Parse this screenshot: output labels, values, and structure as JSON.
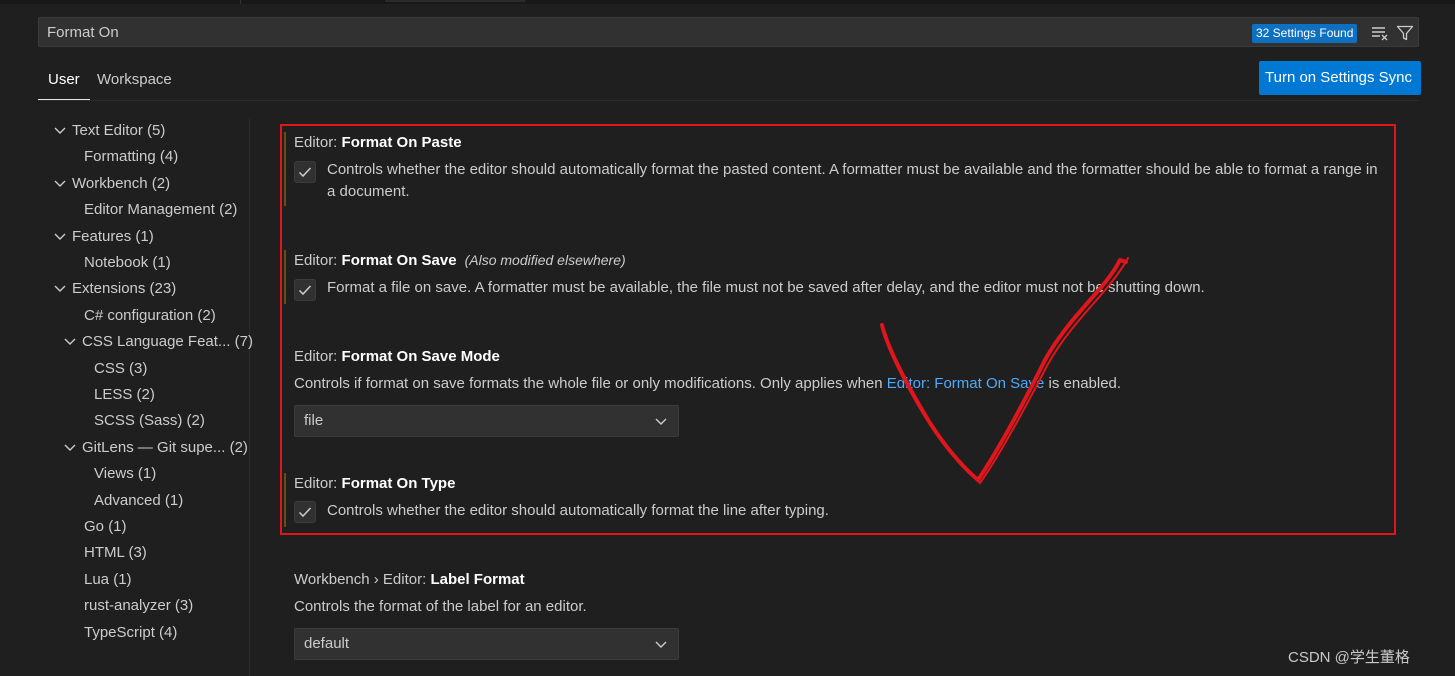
{
  "search": {
    "value": "Format On",
    "results_badge": "32 Settings Found"
  },
  "scope_tabs": [
    {
      "label": "User",
      "active": true
    },
    {
      "label": "Workspace",
      "active": false
    }
  ],
  "sync_button": {
    "label": "Turn on Settings Sync"
  },
  "toc": [
    {
      "label": "Text Editor",
      "count": "(5)",
      "expanded": true,
      "level": 0
    },
    {
      "label": "Formatting",
      "count": "(4)",
      "level": 1
    },
    {
      "label": "Workbench",
      "count": "(2)",
      "expanded": true,
      "level": 0
    },
    {
      "label": "Editor Management",
      "count": "(2)",
      "level": 1
    },
    {
      "label": "Features",
      "count": "(1)",
      "expanded": true,
      "level": 0
    },
    {
      "label": "Notebook",
      "count": "(1)",
      "level": 1
    },
    {
      "label": "Extensions",
      "count": "(23)",
      "expanded": true,
      "level": 0
    },
    {
      "label": "C# configuration",
      "count": "(2)",
      "level": 1
    },
    {
      "label": "CSS Language Feat...",
      "count": "(7)",
      "expanded": true,
      "level": 1
    },
    {
      "label": "CSS",
      "count": "(3)",
      "level": 2
    },
    {
      "label": "LESS",
      "count": "(2)",
      "level": 2
    },
    {
      "label": "SCSS (Sass)",
      "count": "(2)",
      "level": 2
    },
    {
      "label": "GitLens — Git supe...",
      "count": "(2)",
      "expanded": true,
      "level": 1
    },
    {
      "label": "Views",
      "count": "(1)",
      "level": 2
    },
    {
      "label": "Advanced",
      "count": "(1)",
      "level": 2
    },
    {
      "label": "Go",
      "count": "(1)",
      "level": 1
    },
    {
      "label": "HTML",
      "count": "(3)",
      "level": 1
    },
    {
      "label": "Lua",
      "count": "(1)",
      "level": 1
    },
    {
      "label": "rust-analyzer",
      "count": "(3)",
      "level": 1
    },
    {
      "label": "TypeScript",
      "count": "(4)",
      "level": 1
    }
  ],
  "settings": {
    "format_on_paste": {
      "category": "Editor: ",
      "name": "Format On Paste",
      "checked": true,
      "description": "Controls whether the editor should automatically format the pasted content. A formatter must be available and the formatter should be able to format a range in a document."
    },
    "format_on_save": {
      "category": "Editor: ",
      "name": "Format On Save",
      "note": "(Also modified elsewhere)",
      "checked": true,
      "description": "Format a file on save. A formatter must be available, the file must not be saved after delay, and the editor must not be shutting down."
    },
    "format_on_save_mode": {
      "category": "Editor: ",
      "name": "Format On Save Mode",
      "description_before": "Controls if format on save formats the whole file or only modifications. Only applies when ",
      "description_link": "Editor: Format On Save",
      "description_after": " is enabled.",
      "value": "file"
    },
    "format_on_type": {
      "category": "Editor: ",
      "name": "Format On Type",
      "checked": true,
      "description": "Controls whether the editor should automatically format the line after typing."
    },
    "label_format": {
      "category": "Workbench › Editor: ",
      "name": "Label Format",
      "description": "Controls the format of the label for an editor.",
      "value": "default"
    }
  },
  "watermark": "CSDN @学生董格",
  "colors": {
    "accent": "#0078d4",
    "badge": "#0e70c0",
    "link": "#4daafc",
    "annotation": "#e0161c",
    "background": "#1f1f1f"
  }
}
